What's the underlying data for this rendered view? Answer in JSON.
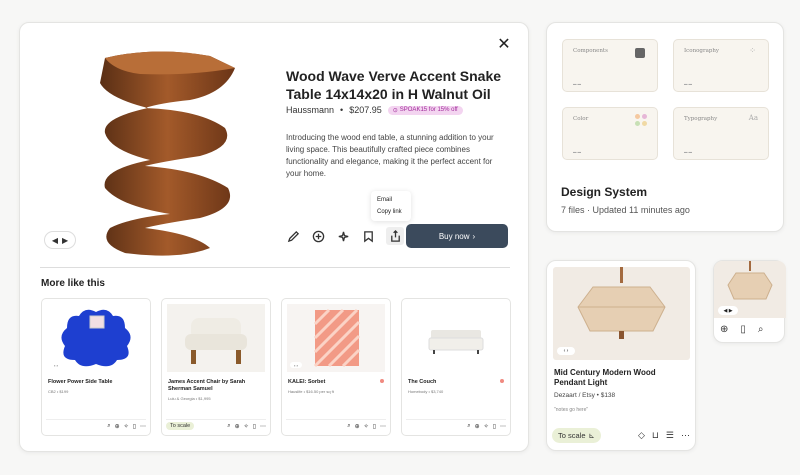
{
  "modal": {
    "close_glyph": "✕",
    "title": "Wood Wave Verve Accent Snake Table 14x14x20 in H Walnut Oil",
    "store": "Haussmann",
    "sep": "•",
    "price": "$207.95",
    "promo": "SPOAK15 for 15% off",
    "description": "Introducing the wood end table, a stunning addition to your living space. This beautifully crafted piece combines functionality and elegance, making it the perfect accent for your home.",
    "share_menu": [
      "Email",
      "Copy link"
    ],
    "buy_label": "Buy now",
    "buy_chevron": "›",
    "more_title": "More like this",
    "pager": {
      "prev": "◀",
      "next": "▶"
    },
    "items": [
      {
        "name": "Flower Power Side Table",
        "sub": "CB2 • $199",
        "to_scale": false,
        "dot": false
      },
      {
        "name": "James Accent Chair by Sarah Sherman Samuel",
        "sub": "Lulu & Georgia • $1,995",
        "to_scale": true,
        "dot": false
      },
      {
        "name": "KALEI: Sorbet",
        "sub": "Hauslife • $16.50 per sq ft",
        "to_scale": false,
        "dot": true
      },
      {
        "name": "The Couch",
        "sub": "Homebody • $3,740",
        "to_scale": false,
        "dot": true
      }
    ],
    "to_scale_label": "To scale"
  },
  "design_system": {
    "tiles": [
      "Components",
      "Iconography",
      "Color",
      "Typography"
    ],
    "title": "Design System",
    "subtitle": "7 files · Updated 11 minutes ago"
  },
  "lamp": {
    "title": "Mid Century Modern Wood Pendant Light",
    "meta": "Dezaart / Etsy • $138",
    "note": "\"notes go here\"",
    "to_scale": "To scale"
  },
  "colors": {
    "buy": "#3b4a5c",
    "promo_bg": "#f3d4f0",
    "promo_fg": "#a02a9a",
    "scale_bg": "#eaf0d7"
  }
}
